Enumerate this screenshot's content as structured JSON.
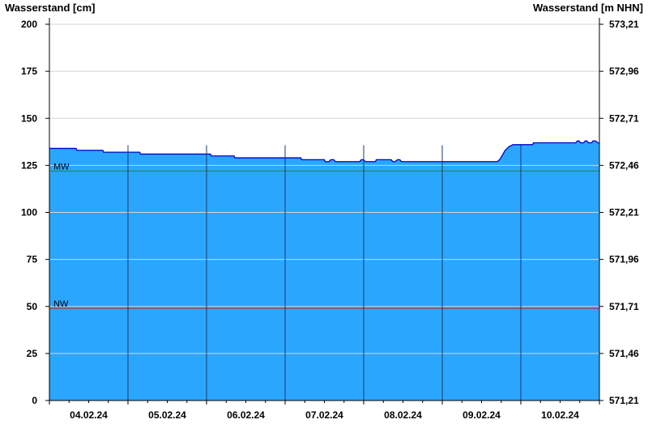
{
  "chart_data": {
    "type": "area",
    "ylabel_left": "Wasserstand [cm]",
    "ylabel_right": "Wasserstand [m NHN]",
    "ylim": [
      0,
      200
    ],
    "yticks": [
      0,
      25,
      50,
      75,
      100,
      125,
      150,
      175,
      200
    ],
    "right_yticks": [
      "571,21",
      "571,46",
      "571,71",
      "571,96",
      "572,21",
      "572,46",
      "572,71",
      "572,96",
      "573,21"
    ],
    "xlim": [
      0,
      7
    ],
    "day_boundaries": [
      1,
      2,
      3,
      4,
      5,
      6
    ],
    "xtick_labels": [
      {
        "x": 0.5,
        "label": "04.02.24"
      },
      {
        "x": 1.5,
        "label": "05.02.24"
      },
      {
        "x": 2.5,
        "label": "06.02.24"
      },
      {
        "x": 3.5,
        "label": "07.02.24"
      },
      {
        "x": 4.5,
        "label": "08.02.24"
      },
      {
        "x": 5.5,
        "label": "09.02.24"
      },
      {
        "x": 6.5,
        "label": "10.02.24"
      }
    ],
    "reference_lines": [
      {
        "label": "MW",
        "value": 122,
        "color": "#1a8a3a"
      },
      {
        "label": "NW",
        "value": 49,
        "color": "#cc2222"
      }
    ],
    "fill_color": "#2ba6ff",
    "line_color": "#0000cc",
    "series": [
      {
        "x": [
          0,
          0.34,
          0.35,
          0.68,
          0.69,
          1.15,
          1.16,
          2.05,
          2.06,
          2.35,
          2.36,
          3.2,
          3.21,
          3.5,
          3.51,
          3.56,
          3.58,
          3.62,
          3.64,
          3.72,
          3.73,
          3.95,
          3.97,
          4.0,
          4.02,
          4.05,
          4.07,
          4.15,
          4.16,
          4.35,
          4.37,
          4.4,
          4.43,
          4.46,
          4.48,
          4.55,
          4.56,
          5.7,
          5.73,
          5.76,
          5.8,
          5.85,
          5.9,
          5.95,
          6.0,
          6.15,
          6.16,
          6.7,
          6.72,
          6.74,
          6.76,
          6.8,
          6.82,
          6.84,
          6.86,
          6.9,
          6.92,
          6.95,
          6.98,
          7.0
        ],
        "y": [
          134,
          134,
          133,
          133,
          132,
          132,
          131,
          131,
          130,
          130,
          129,
          129,
          128,
          128,
          127,
          127,
          128,
          128,
          127,
          127,
          127,
          127,
          128,
          128,
          127,
          127,
          127,
          127,
          128,
          128,
          127,
          127,
          128,
          128,
          127,
          127,
          127,
          127,
          128,
          130,
          133,
          135,
          136,
          136,
          136,
          136,
          137,
          137,
          138,
          138,
          137,
          137,
          138,
          138,
          137,
          137,
          138,
          138,
          137,
          137
        ]
      }
    ]
  }
}
